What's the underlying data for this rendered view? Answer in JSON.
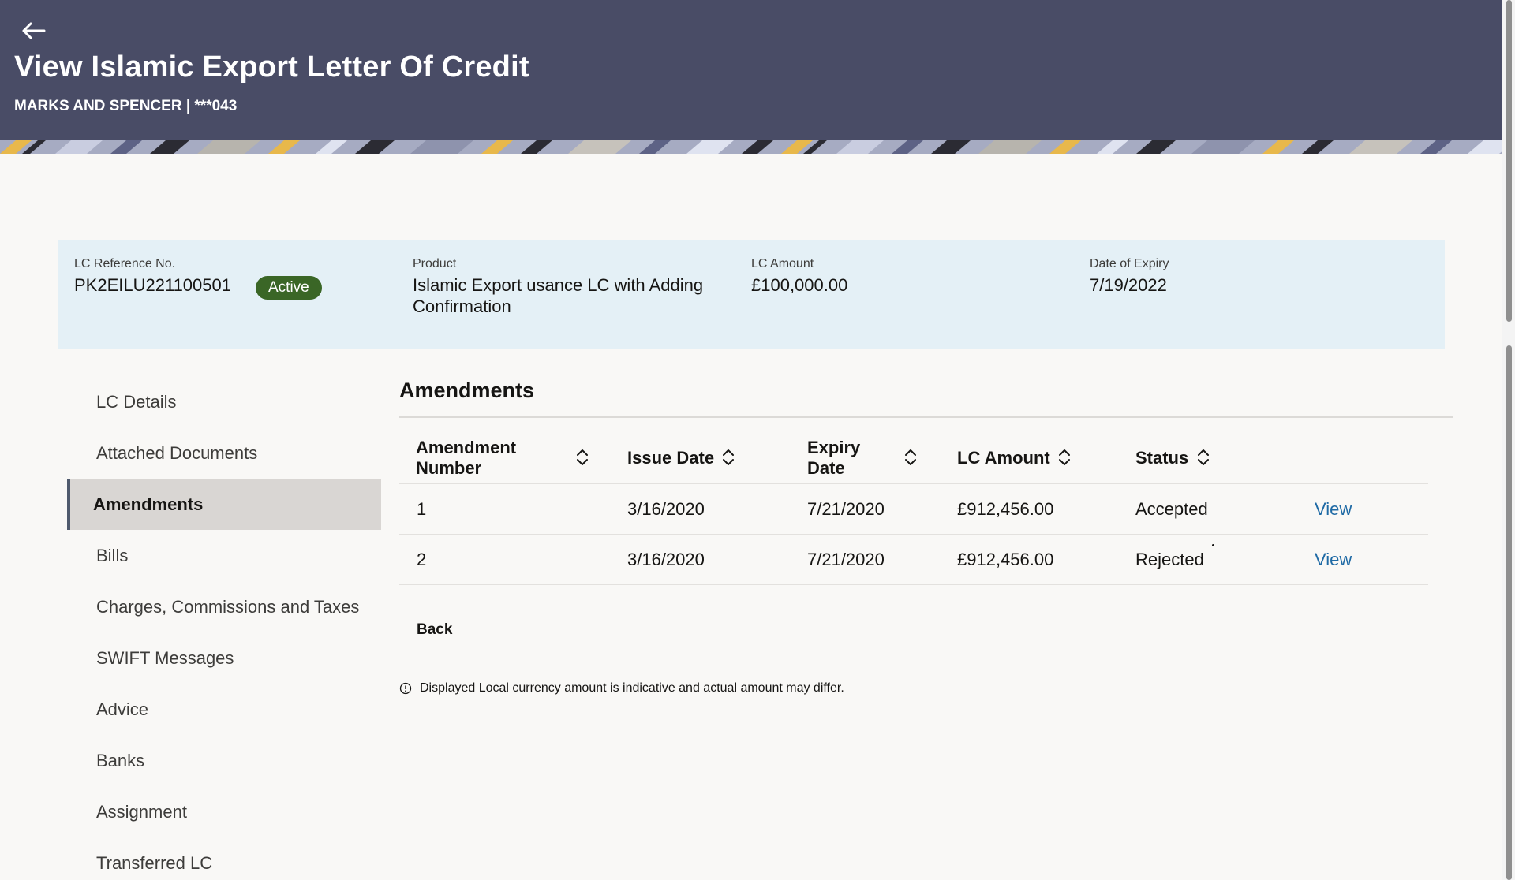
{
  "header": {
    "title": "View Islamic Export Letter Of Credit",
    "subtitle": "MARKS AND SPENCER | ***043",
    "back_icon": "arrow-left-icon"
  },
  "summary": {
    "reference_label": "LC Reference No.",
    "reference_value": "PK2EILU221100501",
    "status": "Active",
    "product_label": "Product",
    "product_value": "Islamic Export usance LC with Adding Confirmation",
    "amount_label": "LC Amount",
    "amount_value": "£100,000.00",
    "expiry_label": "Date of Expiry",
    "expiry_value": "7/19/2022"
  },
  "sidenav": {
    "items": [
      {
        "label": "LC Details"
      },
      {
        "label": "Attached Documents"
      },
      {
        "label": "Amendments",
        "active": true
      },
      {
        "label": "Bills"
      },
      {
        "label": "Charges, Commissions and Taxes"
      },
      {
        "label": "SWIFT Messages"
      },
      {
        "label": "Advice"
      },
      {
        "label": "Banks"
      },
      {
        "label": "Assignment"
      },
      {
        "label": "Transferred LC"
      }
    ]
  },
  "main": {
    "title": "Amendments",
    "columns": [
      "Amendment Number",
      "Issue Date",
      "Expiry Date",
      "LC Amount",
      "Status"
    ],
    "rows": [
      {
        "number": "1",
        "issue_date": "3/16/2020",
        "expiry_date": "7/21/2020",
        "amount": "£912,456.00",
        "status": "Accepted",
        "action": "View"
      },
      {
        "number": "2",
        "issue_date": "3/16/2020",
        "expiry_date": "7/21/2020",
        "amount": "£912,456.00",
        "status": "Rejected",
        "action": "View"
      }
    ],
    "back_label": "Back",
    "note": "Displayed Local currency amount is indicative and actual amount may differ."
  },
  "colors": {
    "header_bg": "#494c66",
    "summary_bg": "#e4f0f6",
    "status_active": "#3a6626",
    "link": "#1f6aa5"
  }
}
